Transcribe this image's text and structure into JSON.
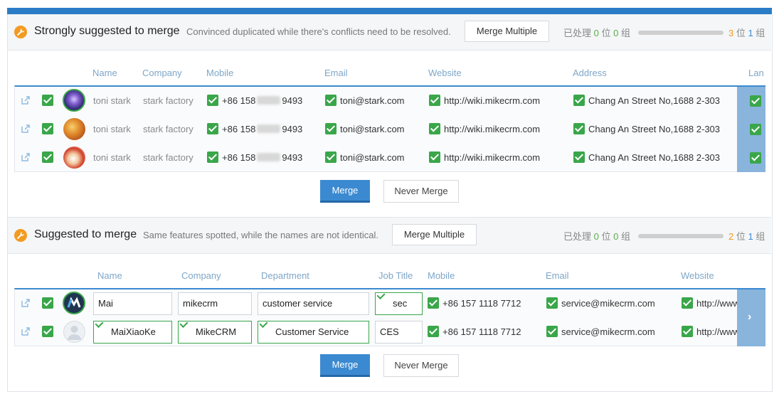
{
  "sections": [
    {
      "title": "Strongly suggested to merge",
      "description": "Convinced duplicated while there's conflicts need to be resolved.",
      "merge_multiple": "Merge Multiple",
      "progress": {
        "prefix": "已处理",
        "done": "0",
        "unit1": "位",
        "groups_done": "0",
        "unit2": "组",
        "total": "3",
        "total_unit": "位",
        "total_groups": "1",
        "total_groups_unit": "组"
      },
      "columns": [
        "Name",
        "Company",
        "Mobile",
        "Email",
        "Website",
        "Address",
        "Lan"
      ],
      "rows": [
        {
          "name": "toni stark",
          "company": "stark factory",
          "mobile_a": "+86 158",
          "mobile_b": "9493",
          "email": "toni@stark.com",
          "website": "http://wiki.mikecrm.com",
          "address": "Chang An Street No,1688 2-303",
          "avatar": "avatar-night-sky"
        },
        {
          "name": "toni stark",
          "company": "stark factory",
          "mobile_a": "+86 158",
          "mobile_b": "9493",
          "email": "toni@stark.com",
          "website": "http://wiki.mikecrm.com",
          "address": "Chang An Street No,1688 2-303",
          "avatar": "avatar-food"
        },
        {
          "name": "toni stark",
          "company": "stark factory",
          "mobile_a": "+86 158",
          "mobile_b": "9493",
          "email": "toni@stark.com",
          "website": "http://wiki.mikecrm.com",
          "address": "Chang An Street No,1688 2-303",
          "avatar": "avatar-dessert"
        }
      ],
      "merge": "Merge",
      "never_merge": "Never Merge"
    },
    {
      "title": "Suggested to merge",
      "description": "Same features spotted, while the names are not identical.",
      "merge_multiple": "Merge Multiple",
      "progress": {
        "prefix": "已处理",
        "done": "0",
        "unit1": "位",
        "groups_done": "0",
        "unit2": "组",
        "total": "2",
        "total_unit": "位",
        "total_groups": "1",
        "total_groups_unit": "组"
      },
      "columns": [
        "Name",
        "Company",
        "Department",
        "Job Title",
        "Mobile",
        "Email",
        "Website"
      ],
      "rows": [
        {
          "name": "Mai",
          "company": "mikecrm",
          "department": "customer service",
          "job_title": "sec",
          "mobile": "+86 157 1118 7712",
          "email": "service@mikecrm.com",
          "website": "http://www.mikec",
          "avatar": "avatar-logo-m"
        },
        {
          "name": "MaiXiaoKe",
          "company": "MikeCRM",
          "department": "Customer Service",
          "job_title": "CES",
          "mobile": "+86 157 1118 7712",
          "email": "service@mikecrm.com",
          "website": "http://www.mikec",
          "avatar": "avatar-placeholder"
        }
      ],
      "merge": "Merge",
      "never_merge": "Never Merge"
    }
  ],
  "colors": {
    "accent": "#3b8ad1",
    "check": "#3aa64a",
    "warning": "#f39a21",
    "scroll_pane": "#89b4dc"
  }
}
